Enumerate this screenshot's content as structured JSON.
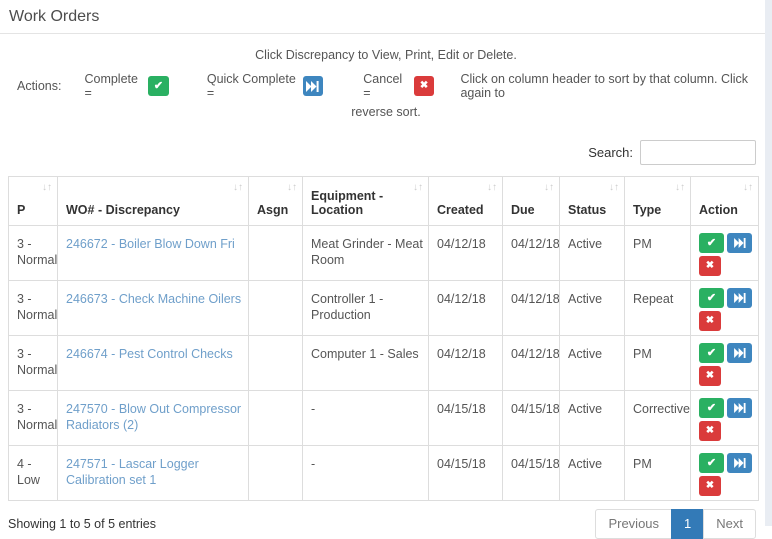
{
  "page": {
    "title": "Work Orders"
  },
  "hints": {
    "discrepancy": "Click Discrepancy to View, Print, Edit or Delete.",
    "sort_line1": "Click on column header to sort by that column. Click again to",
    "sort_line2": "reverse sort."
  },
  "legend": {
    "actions_label": "Actions:",
    "complete_label": "Complete =",
    "quick_complete_label": "Quick Complete =",
    "cancel_label": "Cancel ="
  },
  "search": {
    "label": "Search:",
    "value": "",
    "placeholder": ""
  },
  "table": {
    "columns": [
      "P",
      "WO# - Discrepancy",
      "Asgn",
      "Equipment - Location",
      "Created",
      "Due",
      "Status",
      "Type",
      "Action"
    ],
    "rows": [
      {
        "priority": "3 - Normal",
        "wo": "246672 - Boiler Blow Down Fri",
        "asgn": "",
        "equipment": "Meat Grinder - Meat Room",
        "created": "04/12/18",
        "due": "04/12/18",
        "status": "Active",
        "type": "PM"
      },
      {
        "priority": "3 - Normal",
        "wo": "246673 - Check Machine Oilers",
        "asgn": "",
        "equipment": "Controller 1 - Production",
        "created": "04/12/18",
        "due": "04/12/18",
        "status": "Active",
        "type": "Repeat"
      },
      {
        "priority": "3 - Normal",
        "wo": "246674 - Pest Control Checks",
        "asgn": "",
        "equipment": "Computer 1 - Sales",
        "created": "04/12/18",
        "due": "04/12/18",
        "status": "Active",
        "type": "PM"
      },
      {
        "priority": "3 - Normal",
        "wo": "247570 - Blow Out Compressor Radiators (2)",
        "asgn": "",
        "equipment": "-",
        "created": "04/15/18",
        "due": "04/15/18",
        "status": "Active",
        "type": "Corrective"
      },
      {
        "priority": "4 - Low",
        "wo": "247571 - Lascar Logger Calibration set 1",
        "asgn": "",
        "equipment": "-",
        "created": "04/15/18",
        "due": "04/15/18",
        "status": "Active",
        "type": "PM"
      }
    ]
  },
  "footer": {
    "showing": "Showing 1 to 5 of 5 entries"
  },
  "pagination": {
    "previous": "Previous",
    "current_page": "1",
    "next": "Next"
  },
  "icons": {
    "complete": "check-icon",
    "quick_complete": "fast-forward-icon",
    "cancel": "x-icon",
    "sort": "sort-arrows-icon"
  },
  "colors": {
    "complete_green": "#2ab062",
    "quick_complete_blue": "#3e86bf",
    "cancel_red": "#da3b3b",
    "link_blue": "#6f9fca",
    "pagination_active_blue": "#337ab7",
    "border_gray": "#dddddd"
  }
}
